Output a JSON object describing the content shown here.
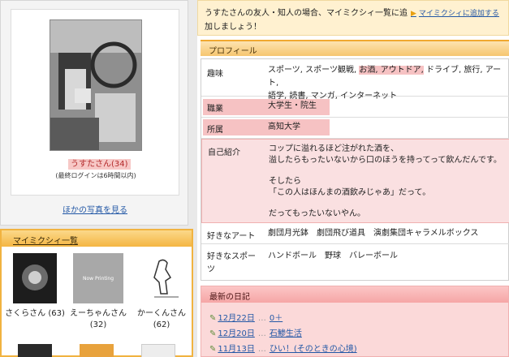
{
  "left": {
    "user_name": "うすたさん(34)",
    "last_login": "(最終ログインは6時間以内)",
    "more_photos": "ほかの写真を見る",
    "friends_title": "マイミクシィ一覧",
    "friends": [
      {
        "name": "さくらさん (63)"
      },
      {
        "name": "えーちゃんさん (32)",
        "photo_text": "Now Printing"
      },
      {
        "name": "かーくんさん (62)"
      }
    ]
  },
  "invite": {
    "text": "うすたさんの友人・知人の場合、マイミクシィ一覧に追加しましょう！",
    "link": "マイミクシィに追加する"
  },
  "profile": {
    "title": "プロフィール",
    "hobby_label": "趣味",
    "hobby_pre": "スポーツ, スポーツ観戦, ",
    "hobby_hl": "お酒, アウトドア,",
    "hobby_post": " ドライブ, 旅行, アート,",
    "hobby_line2": "語学, 読書, マンガ, インターネット",
    "job_label": "職業",
    "job_value": "大学生・院生",
    "affil_label": "所属",
    "affil_value": "高知大学",
    "intro_label": "自己紹介",
    "intro_lines": [
      "コップに溢れるほど注がれた酒を、",
      "溢したらもったいないから口のほうを持ってって飲んだんです。",
      "そしたら",
      "「この人はほんまの酒飲みじゃあ」だって。",
      "だってもったいないやん。"
    ],
    "art_label": "好きなアート",
    "art_value": "劇団月光鉢　劇団飛び道具　演劇集団キャラメルボックス",
    "sport_label": "好きなスポーツ",
    "sport_value": "ハンドボール　野球　バレーボール"
  },
  "diary": {
    "title": "最新の日記",
    "entries": [
      {
        "date": "12月22日",
        "title": "0＋"
      },
      {
        "date": "12月20日",
        "title": "石鯵生活"
      },
      {
        "date": "11月13日",
        "title": "ひい！(そのときの心境)"
      }
    ]
  }
}
